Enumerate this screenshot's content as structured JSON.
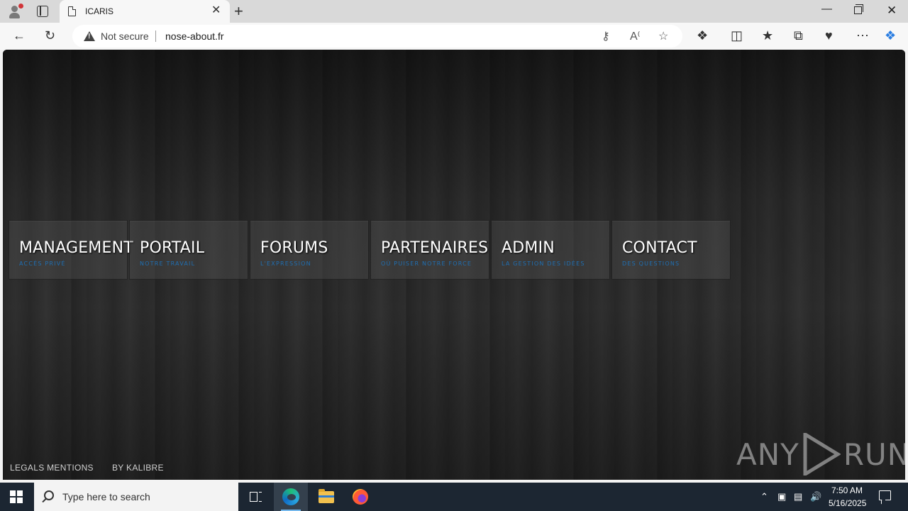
{
  "browser": {
    "tab_title": "ICARIS",
    "tab_close": "✕",
    "new_tab": "+",
    "security_label": "Not secure",
    "url": "nose-about.fr"
  },
  "site": {
    "nav": [
      {
        "title": "MANAGEMENT",
        "subtitle": "ACCÈS PRIVÉ"
      },
      {
        "title": "PORTAIL",
        "subtitle": "NOTRE TRAVAIL"
      },
      {
        "title": "FORUMS",
        "subtitle": "L'EXPRESSION"
      },
      {
        "title": "PARTENAIRES",
        "subtitle": "OÙ PUISER NOTRE FORCE"
      },
      {
        "title": "ADMIN",
        "subtitle": "LA GESTION DES IDÉES"
      },
      {
        "title": "CONTACT",
        "subtitle": "DES QUESTIONS"
      }
    ],
    "footer": {
      "legal": "LEGALS MENTIONS",
      "credit": "BY KALIBRE"
    },
    "watermark_left": "ANY",
    "watermark_right": "RUN"
  },
  "taskbar": {
    "search_placeholder": "Type here to search",
    "time": "7:50 AM",
    "date": "5/16/2025"
  },
  "colors": {
    "nav_subtitle": "#1f6fb3",
    "taskbar": "#1c2632",
    "tabstrip": "#d9d9d9"
  }
}
